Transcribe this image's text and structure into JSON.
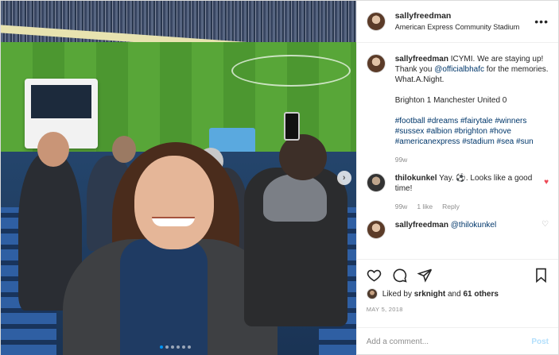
{
  "header": {
    "username": "sallyfreedman",
    "location": "American Express Community Stadium",
    "more_icon": "more-horizontal-icon"
  },
  "caption": {
    "username": "sallyfreedman",
    "line1": "ICYMI. We are staying up!",
    "line2_pre": "Thank you ",
    "mention": "@officialbhafc",
    "line2_post": " for the memories. What.A.Night.",
    "score": "Brighton 1 Manchester United 0",
    "hashtags": "#football #dreams #fairytale #winners #sussex #albion #brighton #hove #americanexpress #stadium #sea #sun",
    "age": "99w"
  },
  "comments": [
    {
      "username": "thilokunkel",
      "text": "Yay. ⚽. Looks like a good time!",
      "age": "99w",
      "likes": "1 like",
      "reply": "Reply"
    },
    {
      "username": "sallyfreedman",
      "mention": "@thilokunkel"
    }
  ],
  "likes": {
    "liked_by": "Liked by ",
    "user": "srknight",
    "and": " and ",
    "others": "61 others"
  },
  "date": "MAY 5, 2018",
  "add_comment": {
    "placeholder": "Add a comment...",
    "post_label": "Post"
  },
  "carousel": {
    "next_icon": "chevron-right-icon",
    "dot_count": 6,
    "active_index": 0
  },
  "icons": [
    "heart-icon",
    "comment-icon",
    "share-icon",
    "bookmark-icon"
  ],
  "colors": {
    "link": "#00376b",
    "like_red": "#ed4956",
    "muted": "#8e8e8e",
    "post_disabled": "#b2dffc"
  }
}
